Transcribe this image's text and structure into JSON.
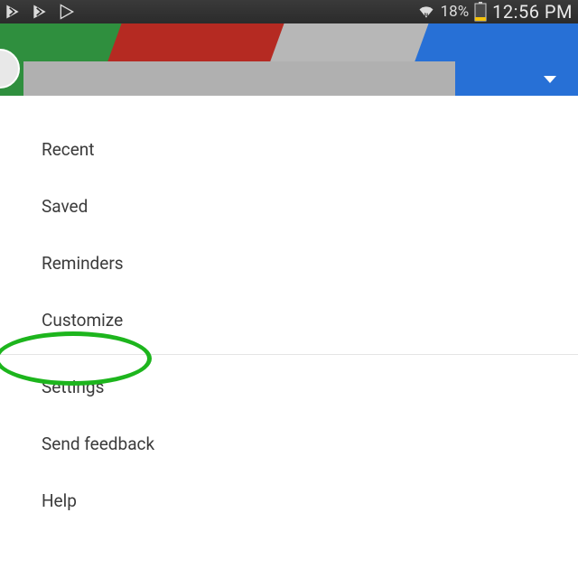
{
  "status": {
    "battery_pct": "18%",
    "time": "12:56 PM"
  },
  "header": {
    "search_placeholder": ""
  },
  "menu": {
    "items": [
      {
        "label": "Recent"
      },
      {
        "label": "Saved"
      },
      {
        "label": "Reminders"
      },
      {
        "label": "Customize"
      }
    ],
    "items2": [
      {
        "label": "Settings"
      },
      {
        "label": "Send feedback"
      },
      {
        "label": "Help"
      }
    ]
  },
  "annotation": {
    "highlighted_item": "Settings"
  }
}
